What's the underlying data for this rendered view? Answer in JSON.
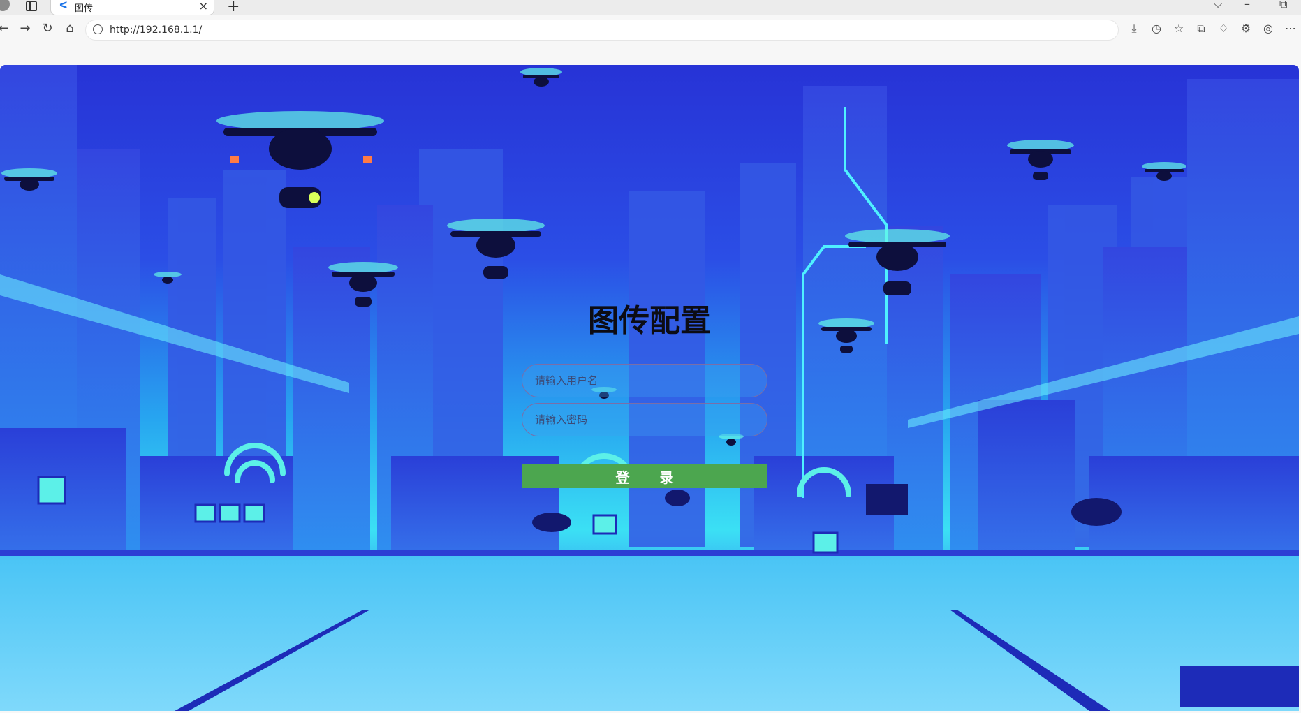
{
  "browser": {
    "tab_title": "图传",
    "new_tab": "+",
    "close_tab": "×",
    "url": "http://192.168.1.1/"
  },
  "login": {
    "title": "图传配置",
    "username_placeholder": "请输入用户名",
    "password_placeholder": "请输入密码",
    "submit_label": "登 录"
  },
  "colors": {
    "login_button": "#4ca64f",
    "sky_top": "#2733d6",
    "horizon": "#3be0f4"
  },
  "icons": [
    "back-icon",
    "forward-icon",
    "refresh-icon",
    "home-icon",
    "site-info-icon",
    "download-icon",
    "history-icon",
    "favorites-icon",
    "collections-icon",
    "notifications-icon",
    "extensions-icon",
    "copilot-icon",
    "more-icon"
  ]
}
